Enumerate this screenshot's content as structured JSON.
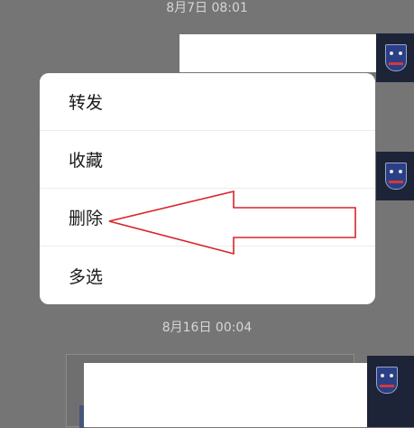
{
  "chat": {
    "timestamp_top": "8月7日 08:01",
    "timestamp_mid": "8月16日 00:04"
  },
  "menu": {
    "items": [
      {
        "label": "转发"
      },
      {
        "label": "收藏"
      },
      {
        "label": "删除"
      },
      {
        "label": "多选"
      }
    ]
  },
  "annotation": {
    "arrow_color": "#d9232b",
    "points_to": "删除"
  },
  "colors": {
    "dim_overlay": "#757575",
    "menu_bg": "#ffffff",
    "text": "#1a1a1a"
  },
  "icons": {
    "avatar": "team-badge-avatar",
    "annotation": "red-outline-arrow-left"
  }
}
